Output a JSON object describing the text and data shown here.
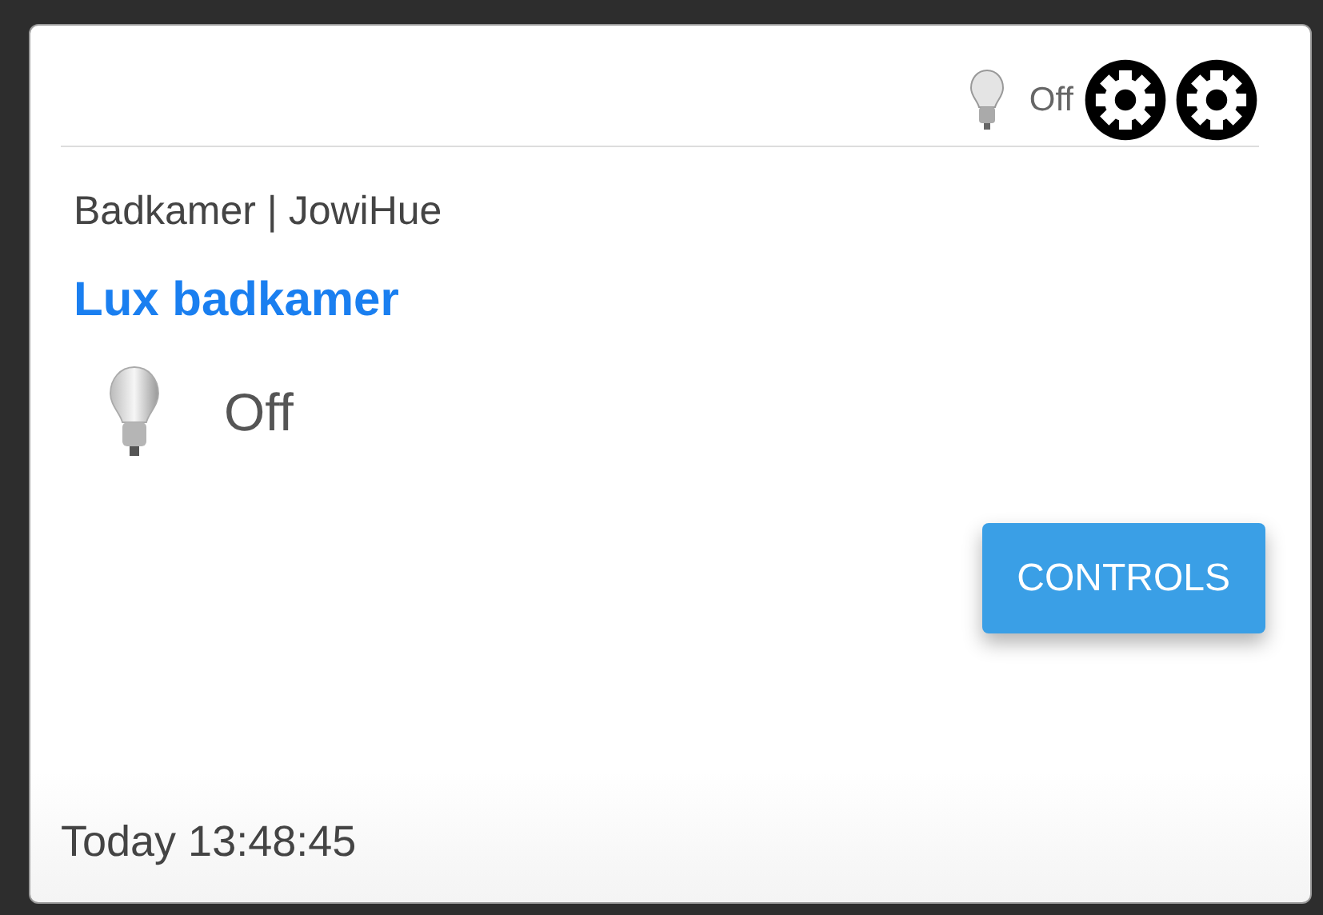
{
  "header": {
    "status": "Off"
  },
  "device": {
    "location": "Badkamer | JowiHue",
    "name": "Lux badkamer",
    "status": "Off"
  },
  "controls_button": {
    "label": "CONTROLS"
  },
  "last_update": "Today 13:48:45"
}
